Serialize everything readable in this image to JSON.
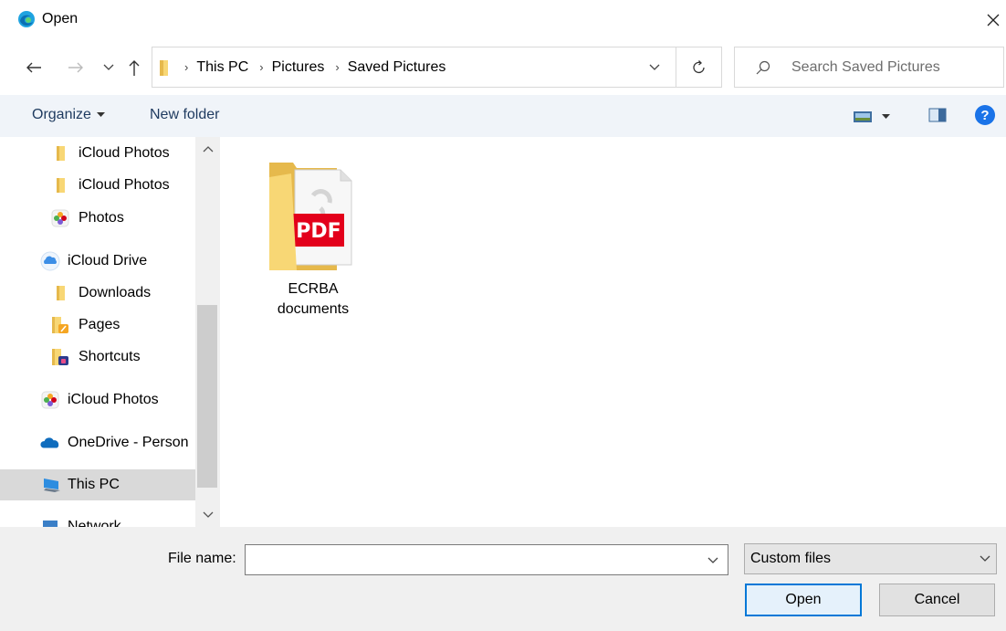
{
  "window": {
    "title": "Open"
  },
  "address": {
    "crumbs": [
      "This PC",
      "Pictures",
      "Saved Pictures"
    ]
  },
  "search": {
    "placeholder": "Search Saved Pictures"
  },
  "toolbar": {
    "organize_label": "Organize",
    "new_folder_label": "New folder"
  },
  "nav": {
    "items": [
      {
        "label": "iCloud Photos",
        "icon": "folder-icon"
      },
      {
        "label": "iCloud Photos",
        "icon": "folder-icon"
      },
      {
        "label": "Photos",
        "icon": "photos-icon"
      },
      {
        "label": "iCloud Drive",
        "icon": "icloud-icon"
      },
      {
        "label": "Downloads",
        "icon": "folder-icon"
      },
      {
        "label": "Pages",
        "icon": "pages-folder-icon"
      },
      {
        "label": "Shortcuts",
        "icon": "shortcuts-folder-icon"
      },
      {
        "label": "iCloud Photos",
        "icon": "photos-icon"
      },
      {
        "label": "OneDrive - Person",
        "icon": "onedrive-icon"
      },
      {
        "label": "This PC",
        "icon": "this-pc-icon",
        "selected": true
      },
      {
        "label": "Network",
        "icon": "network-icon"
      }
    ]
  },
  "content": {
    "items": [
      {
        "name_line1": "ECRBA",
        "name_line2": "documents",
        "icon": "pdf-folder-icon",
        "badge": "PDF"
      }
    ]
  },
  "footer": {
    "file_name_label": "File name:",
    "file_name_value": "",
    "file_type_value": "Custom files",
    "open_label": "Open",
    "cancel_label": "Cancel"
  },
  "colors": {
    "accent": "#0078d7",
    "folder": "#f8d775",
    "pdf_red": "#e3001b",
    "help_blue": "#1a73e8"
  }
}
